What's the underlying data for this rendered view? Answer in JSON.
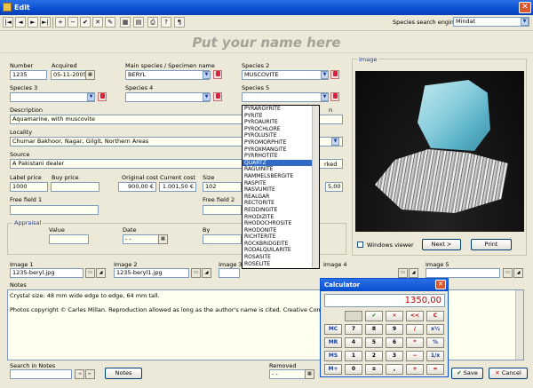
{
  "window": {
    "title": "Edit",
    "close": "✕"
  },
  "toolbar": {
    "buttons": [
      "|◄",
      "◄",
      "►",
      "►|",
      "+",
      "−",
      "✔",
      "✕",
      "✎",
      "▦",
      "▤",
      "⎙",
      "?",
      "¶"
    ],
    "species_engine_label": "Species search engine",
    "species_engine_value": "Mindat"
  },
  "banner": "Put your name here",
  "labels": {
    "number": "Number",
    "acquired": "Acquired",
    "main_species": "Main species / Specimen name",
    "species2": "Species 2",
    "species3": "Species 3",
    "species4": "Species 4",
    "species5": "Species 5",
    "description": "Description",
    "locality": "Locality",
    "source": "Source",
    "label_price": "Label price",
    "buy_price": "Buy price",
    "original_cost": "Original cost",
    "current_cost": "Current cost",
    "size": "Size",
    "free1": "Free field 1",
    "free2": "Free field 2",
    "appraisal": "Appraisal",
    "value": "Value",
    "date": "Date",
    "by": "By",
    "image": "Image",
    "image1": "Image 1",
    "image2": "Image 2",
    "image3": "Image 3",
    "image4": "Image 4",
    "image5": "Image 5",
    "notes": "Notes",
    "search_notes": "Search in Notes",
    "removed": "Removed",
    "partial_right": "n",
    "marked": "rked"
  },
  "values": {
    "number": "1235",
    "acquired": "05-11-2005",
    "main_species": "BERYL",
    "species2": "MUSCOVITE",
    "species3": "",
    "species4": "",
    "species5": "",
    "description": "Aquamarine, with muscovite",
    "locality": "Chumar Bakhoor, Nagar, Gilgit, Northern Areas",
    "source": "A Pakistani dealer",
    "label_price": "1000",
    "buy_price": "",
    "original_cost": "900,00 €",
    "current_cost": "1.001,50 €",
    "size": "102",
    "right_value": "5,00",
    "date": "- -",
    "removed": "- -",
    "image1": "1235-beryl.jpg",
    "image2": "1235-beryl1.jpg"
  },
  "dropdown_items": [
    "PYRARGYRITE",
    "PYRITE",
    "PYROAURITE",
    "PYROCHLORE",
    "PYROLUSITE",
    "PYROMORPHITE",
    "PYROXMANGITE",
    "PYRRHOTITE",
    "QUARTZ",
    "RAGUINITE",
    "RAMMELSBERGITE",
    "RASPITE",
    "RASVUMITE",
    "REALGAR",
    "RECTORITE",
    "REDDINGITE",
    "RHODIZITE",
    "RHODOCHROSITE",
    "RHODONITE",
    "RICHTERITE",
    "ROCKBRIDGEITE",
    "RODALQUILARITE",
    "ROSASITE",
    "ROSELITE"
  ],
  "dropdown_selected": "QUARTZ",
  "image_panel": {
    "windows_viewer": "Windows viewer",
    "next": "Next >",
    "print": "Print"
  },
  "notes_text": {
    "line1": "Crystal size: 48 mm wide edge to edge, 64 mm tall.",
    "line2": "Photos copyright © Carles Millan. Reproduction allowed as long as the author's name is cited. Creative Commons Attribution"
  },
  "buttons": {
    "notes": "Notes",
    "save": "Save",
    "cancel": "Cancel"
  },
  "calculator": {
    "title": "Calculator",
    "display": "1350,00",
    "row0": [
      "",
      "✔",
      "✕",
      "<<",
      "C"
    ],
    "row1": [
      "MC",
      "7",
      "8",
      "9",
      "/",
      "x½"
    ],
    "row2": [
      "MR",
      "4",
      "5",
      "6",
      "*",
      "%"
    ],
    "row3": [
      "MS",
      "1",
      "2",
      "3",
      "−",
      "1/x"
    ],
    "row4": [
      "M+",
      "0",
      "±",
      ",",
      "+",
      "="
    ]
  }
}
